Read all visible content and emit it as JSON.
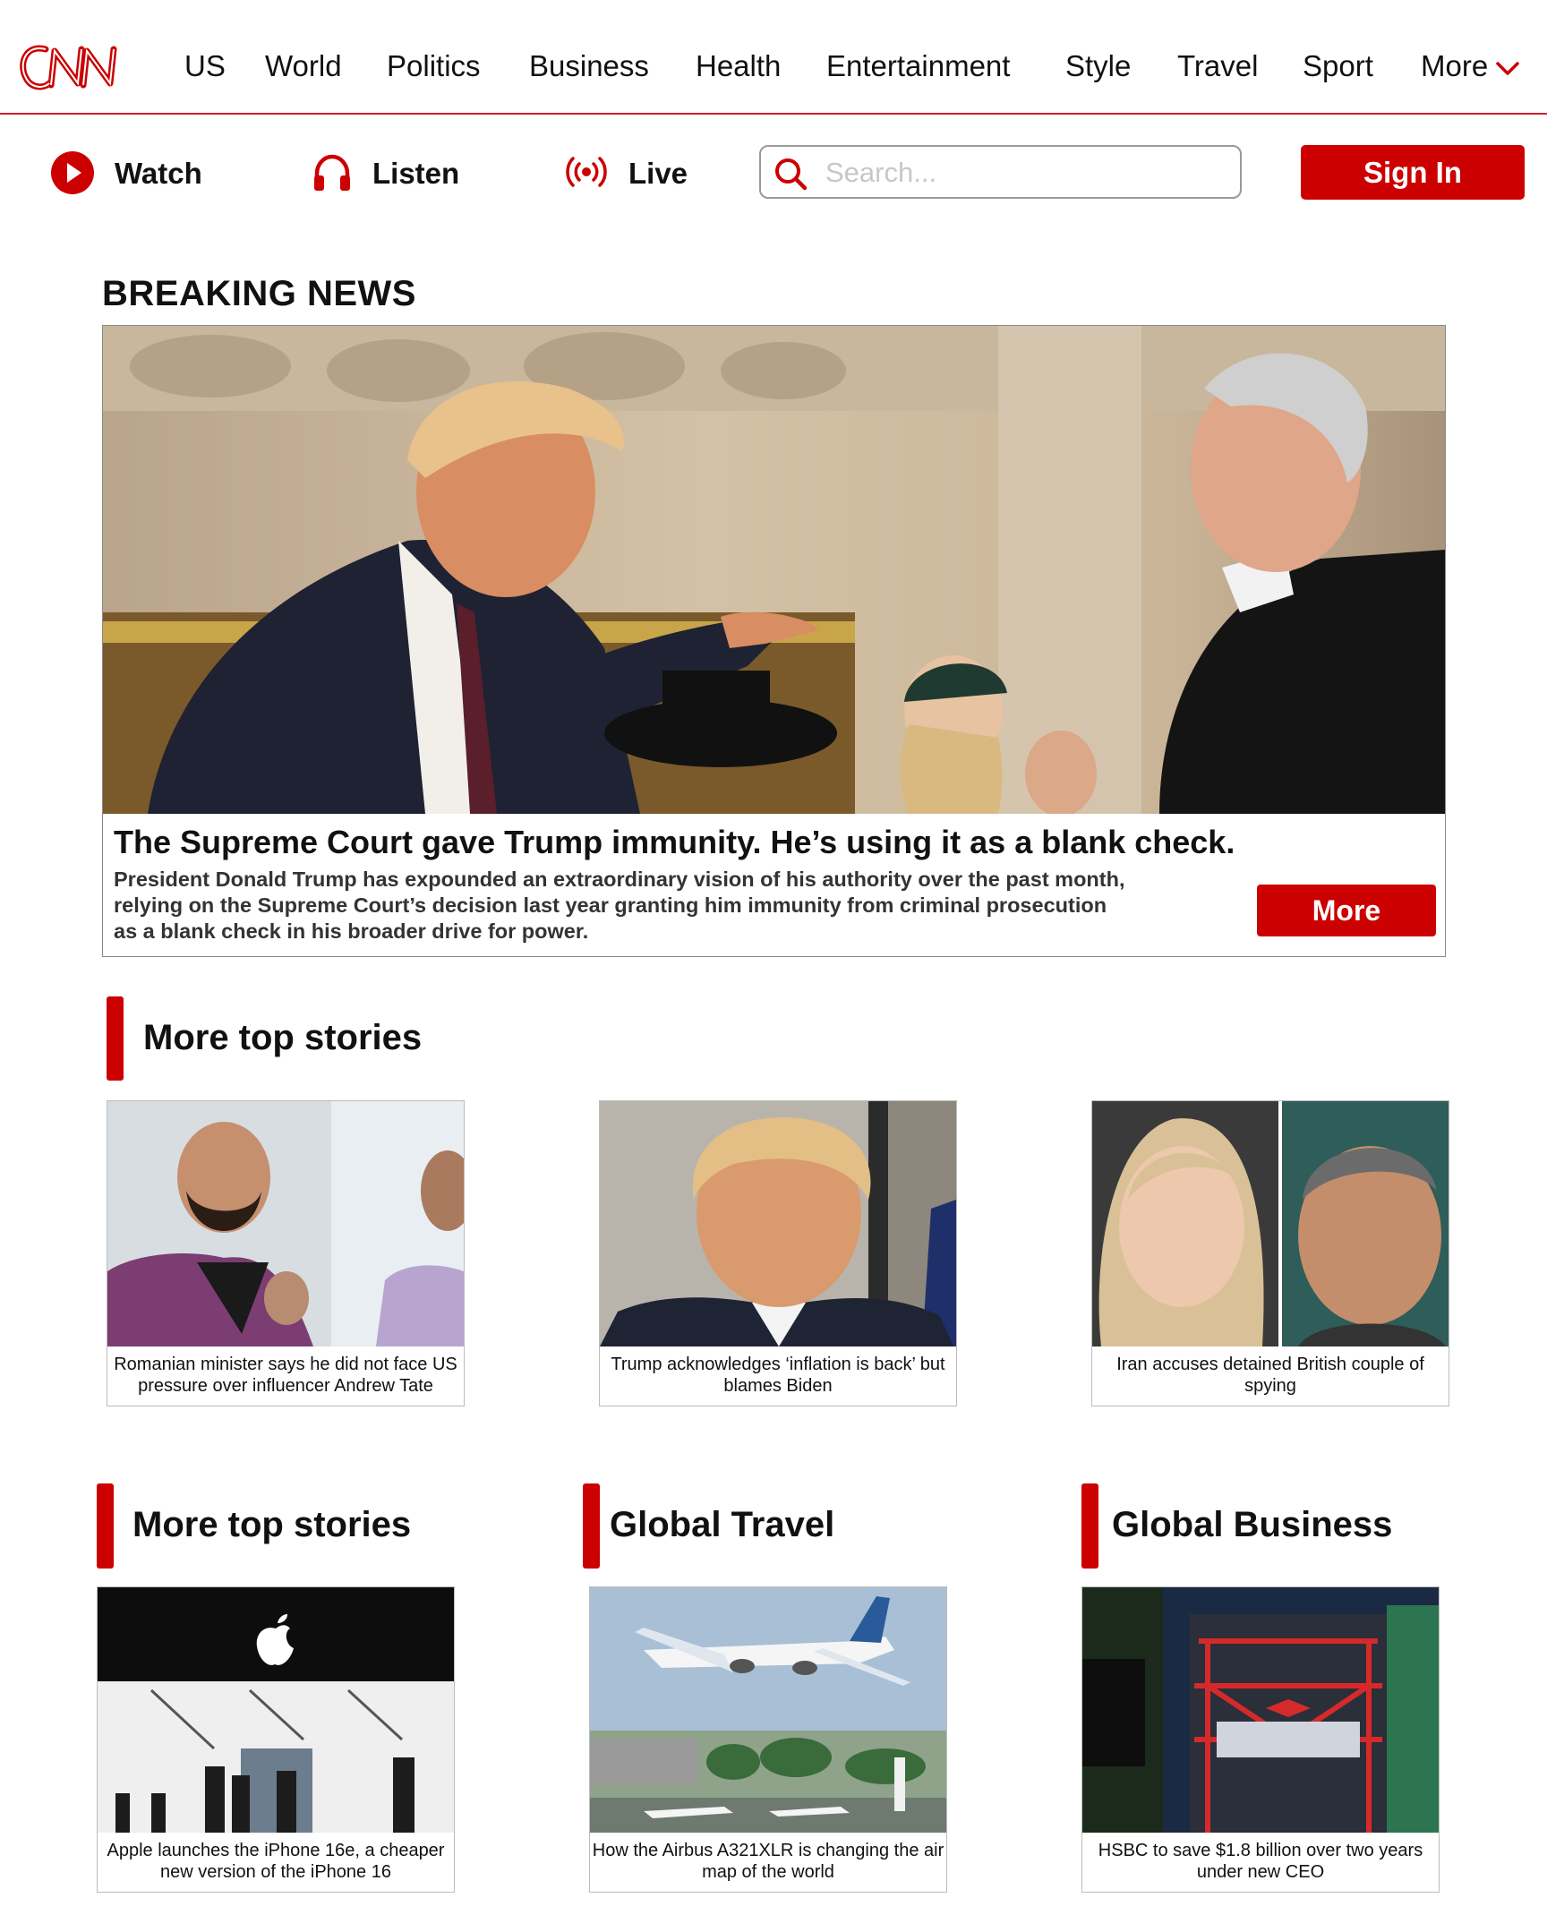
{
  "brand": {
    "logo_text": "CNN",
    "accent": "#cc0000"
  },
  "nav": {
    "items": [
      "US",
      "World",
      "Politics",
      "Business",
      "Health",
      "Entertainment",
      "Style",
      "Travel",
      "Sport",
      "More"
    ]
  },
  "subnav": {
    "watch": "Watch",
    "listen": "Listen",
    "live": "Live",
    "search_placeholder": "Search...",
    "signin": "Sign In"
  },
  "breaking": {
    "label": "BREAKING NEWS",
    "title": "The Supreme Court gave Trump immunity. He’s using it as a blank check.",
    "description": "President Donald Trump has expounded an extraordinary vision of his authority over the past month, relying on the Supreme Court’s decision last year granting him immunity from criminal prosecution as a blank check in his broader drive for power.",
    "more": "More"
  },
  "top_stories": {
    "heading": "More top stories",
    "items": [
      {
        "caption": "Romanian minister says he did not face US pressure over influencer Andrew Tate"
      },
      {
        "caption": "Trump acknowledges ‘inflation is back’ but blames Biden"
      },
      {
        "caption": "Iran accuses detained British couple of spying"
      }
    ]
  },
  "sections": [
    {
      "heading": "More top stories",
      "caption": "Apple launches the iPhone 16e, a cheaper new version of the iPhone 16"
    },
    {
      "heading": "Global Travel",
      "caption": "How the Airbus A321XLR is changing the air map of the world"
    },
    {
      "heading": "Global Business",
      "caption": "HSBC to save $1.8 billion over two years under new CEO"
    }
  ]
}
